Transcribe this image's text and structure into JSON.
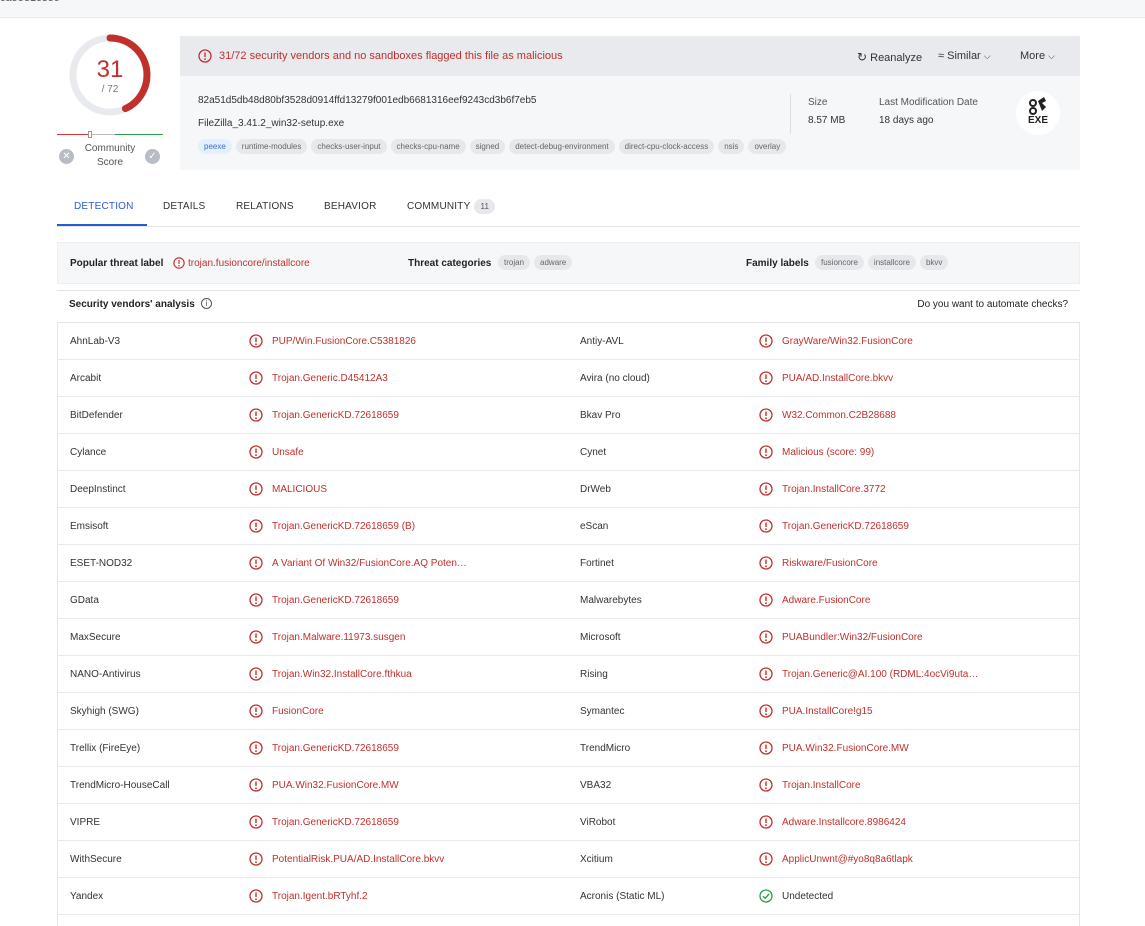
{
  "page": {
    "clipped_top_text": "ca55e1ce59"
  },
  "score": {
    "value": "31",
    "denominator": "/ 72",
    "flagged": 31,
    "total": 72,
    "community_label": "Community Score",
    "accent": "#c0302c"
  },
  "header": {
    "alert": "31/72 security vendors and no sandboxes flagged this file as malicious",
    "actions": {
      "reanalyze": "Reanalyze",
      "similar": "Similar",
      "more": "More"
    },
    "hash": "82a51d5db48d80bf3528d0914ffd13279f001edb6681316eef9243cd3b6f7eb5",
    "filename": "FileZilla_3.41.2_win32-setup.exe",
    "tags": [
      "peexe",
      "runtime-modules",
      "checks-user-input",
      "checks-cpu-name",
      "signed",
      "detect-debug-environment",
      "direct-cpu-clock-access",
      "nsis",
      "overlay"
    ],
    "size_label": "Size",
    "size_value": "8.57 MB",
    "lastmod_label": "Last Modification Date",
    "lastmod_value": "18 days ago",
    "filetype": "EXE"
  },
  "tabs": [
    {
      "label": "DETECTION"
    },
    {
      "label": "DETAILS"
    },
    {
      "label": "RELATIONS"
    },
    {
      "label": "BEHAVIOR"
    },
    {
      "label": "COMMUNITY",
      "badge": "11"
    }
  ],
  "threat": {
    "popular_label": "Popular threat label",
    "popular_value": "trojan.fusioncore/installcore",
    "categories_label": "Threat categories",
    "categories": [
      "trojan",
      "adware"
    ],
    "family_label": "Family labels",
    "families": [
      "fusioncore",
      "installcore",
      "bkvv"
    ]
  },
  "section": {
    "title": "Security vendors' analysis",
    "automate": "Do you want to automate checks?"
  },
  "vendors": [
    {
      "left": {
        "name": "AhnLab-V3",
        "result": "PUP/Win.FusionCore.C5381826",
        "status": "malicious"
      },
      "right": {
        "name": "Antiy-AVL",
        "result": "GrayWare/Win32.FusionCore",
        "status": "malicious"
      }
    },
    {
      "left": {
        "name": "Arcabit",
        "result": "Trojan.Generic.D45412A3",
        "status": "malicious"
      },
      "right": {
        "name": "Avira (no cloud)",
        "result": "PUA/AD.InstallCore.bkvv",
        "status": "malicious"
      }
    },
    {
      "left": {
        "name": "BitDefender",
        "result": "Trojan.GenericKD.72618659",
        "status": "malicious"
      },
      "right": {
        "name": "Bkav Pro",
        "result": "W32.Common.C2B28688",
        "status": "malicious"
      }
    },
    {
      "left": {
        "name": "Cylance",
        "result": "Unsafe",
        "status": "malicious"
      },
      "right": {
        "name": "Cynet",
        "result": "Malicious (score: 99)",
        "status": "malicious"
      }
    },
    {
      "left": {
        "name": "DeepInstinct",
        "result": "MALICIOUS",
        "status": "malicious"
      },
      "right": {
        "name": "DrWeb",
        "result": "Trojan.InstallCore.3772",
        "status": "malicious"
      }
    },
    {
      "left": {
        "name": "Emsisoft",
        "result": "Trojan.GenericKD.72618659 (B)",
        "status": "malicious"
      },
      "right": {
        "name": "eScan",
        "result": "Trojan.GenericKD.72618659",
        "status": "malicious"
      }
    },
    {
      "left": {
        "name": "ESET-NOD32",
        "result": "A Variant Of Win32/FusionCore.AQ Poten…",
        "status": "malicious"
      },
      "right": {
        "name": "Fortinet",
        "result": "Riskware/FusionCore",
        "status": "malicious"
      }
    },
    {
      "left": {
        "name": "GData",
        "result": "Trojan.GenericKD.72618659",
        "status": "malicious"
      },
      "right": {
        "name": "Malwarebytes",
        "result": "Adware.FusionCore",
        "status": "malicious"
      }
    },
    {
      "left": {
        "name": "MaxSecure",
        "result": "Trojan.Malware.11973.susgen",
        "status": "malicious"
      },
      "right": {
        "name": "Microsoft",
        "result": "PUABundler:Win32/FusionCore",
        "status": "malicious"
      }
    },
    {
      "left": {
        "name": "NANO-Antivirus",
        "result": "Trojan.Win32.InstallCore.fthkua",
        "status": "malicious"
      },
      "right": {
        "name": "Rising",
        "result": "Trojan.Generic@AI.100 (RDML:4ocVi9uta…",
        "status": "malicious"
      }
    },
    {
      "left": {
        "name": "Skyhigh (SWG)",
        "result": "FusionCore",
        "status": "malicious"
      },
      "right": {
        "name": "Symantec",
        "result": "PUA.InstallCore!g15",
        "status": "malicious"
      }
    },
    {
      "left": {
        "name": "Trellix (FireEye)",
        "result": "Trojan.GenericKD.72618659",
        "status": "malicious"
      },
      "right": {
        "name": "TrendMicro",
        "result": "PUA.Win32.FusionCore.MW",
        "status": "malicious"
      }
    },
    {
      "left": {
        "name": "TrendMicro-HouseCall",
        "result": "PUA.Win32.FusionCore.MW",
        "status": "malicious"
      },
      "right": {
        "name": "VBA32",
        "result": "Trojan.InstallCore",
        "status": "malicious"
      }
    },
    {
      "left": {
        "name": "VIPRE",
        "result": "Trojan.GenericKD.72618659",
        "status": "malicious"
      },
      "right": {
        "name": "ViRobot",
        "result": "Adware.Installcore.8986424",
        "status": "malicious"
      }
    },
    {
      "left": {
        "name": "WithSecure",
        "result": "PotentialRisk.PUA/AD.InstallCore.bkvv",
        "status": "malicious"
      },
      "right": {
        "name": "Xcitium",
        "result": "ApplicUnwnt@#yo8q8a6tlapk",
        "status": "malicious"
      }
    },
    {
      "left": {
        "name": "Yandex",
        "result": "Trojan.Igent.bRTyhf.2",
        "status": "malicious"
      },
      "right": {
        "name": "Acronis (Static ML)",
        "result": "Undetected",
        "status": "clean"
      }
    },
    {
      "left": {
        "name": "",
        "result": "",
        "status": "malicious"
      },
      "right": {
        "name": "",
        "result": "",
        "status": "clean"
      }
    }
  ],
  "colors": {
    "malicious": "#c0302c",
    "clean": "#2a9d4e",
    "active_tab": "#2a5bd7"
  }
}
